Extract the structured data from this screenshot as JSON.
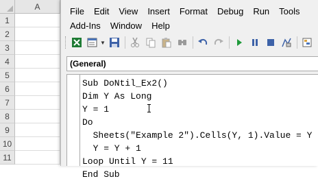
{
  "excel": {
    "column_header": "A",
    "row_headers": [
      "1",
      "2",
      "3",
      "4",
      "5",
      "6",
      "7",
      "8",
      "9",
      "10",
      "11"
    ]
  },
  "vbe": {
    "menu_row1": [
      "File",
      "Edit",
      "View",
      "Insert",
      "Format",
      "Debug",
      "Run",
      "Tools"
    ],
    "menu_row2": [
      "Add-Ins",
      "Window",
      "Help"
    ],
    "toolbar_icons": [
      "excel-icon",
      "insert-module-icon",
      "save-icon",
      "cut-icon",
      "copy-icon",
      "paste-icon",
      "find-icon",
      "undo-icon",
      "redo-icon",
      "run-icon",
      "break-icon",
      "reset-icon",
      "design-mode-icon",
      "project-explorer-icon"
    ],
    "object_dropdown": "(General)",
    "code_lines": [
      "Sub DoNtil_Ex2()",
      "Dim Y As Long",
      "Y = 1",
      "Do",
      "  Sheets(\"Example 2\").Cells(Y, 1).Value = Y",
      "  Y = Y + 1",
      "Loop Until Y = 11",
      "End Sub"
    ]
  }
}
